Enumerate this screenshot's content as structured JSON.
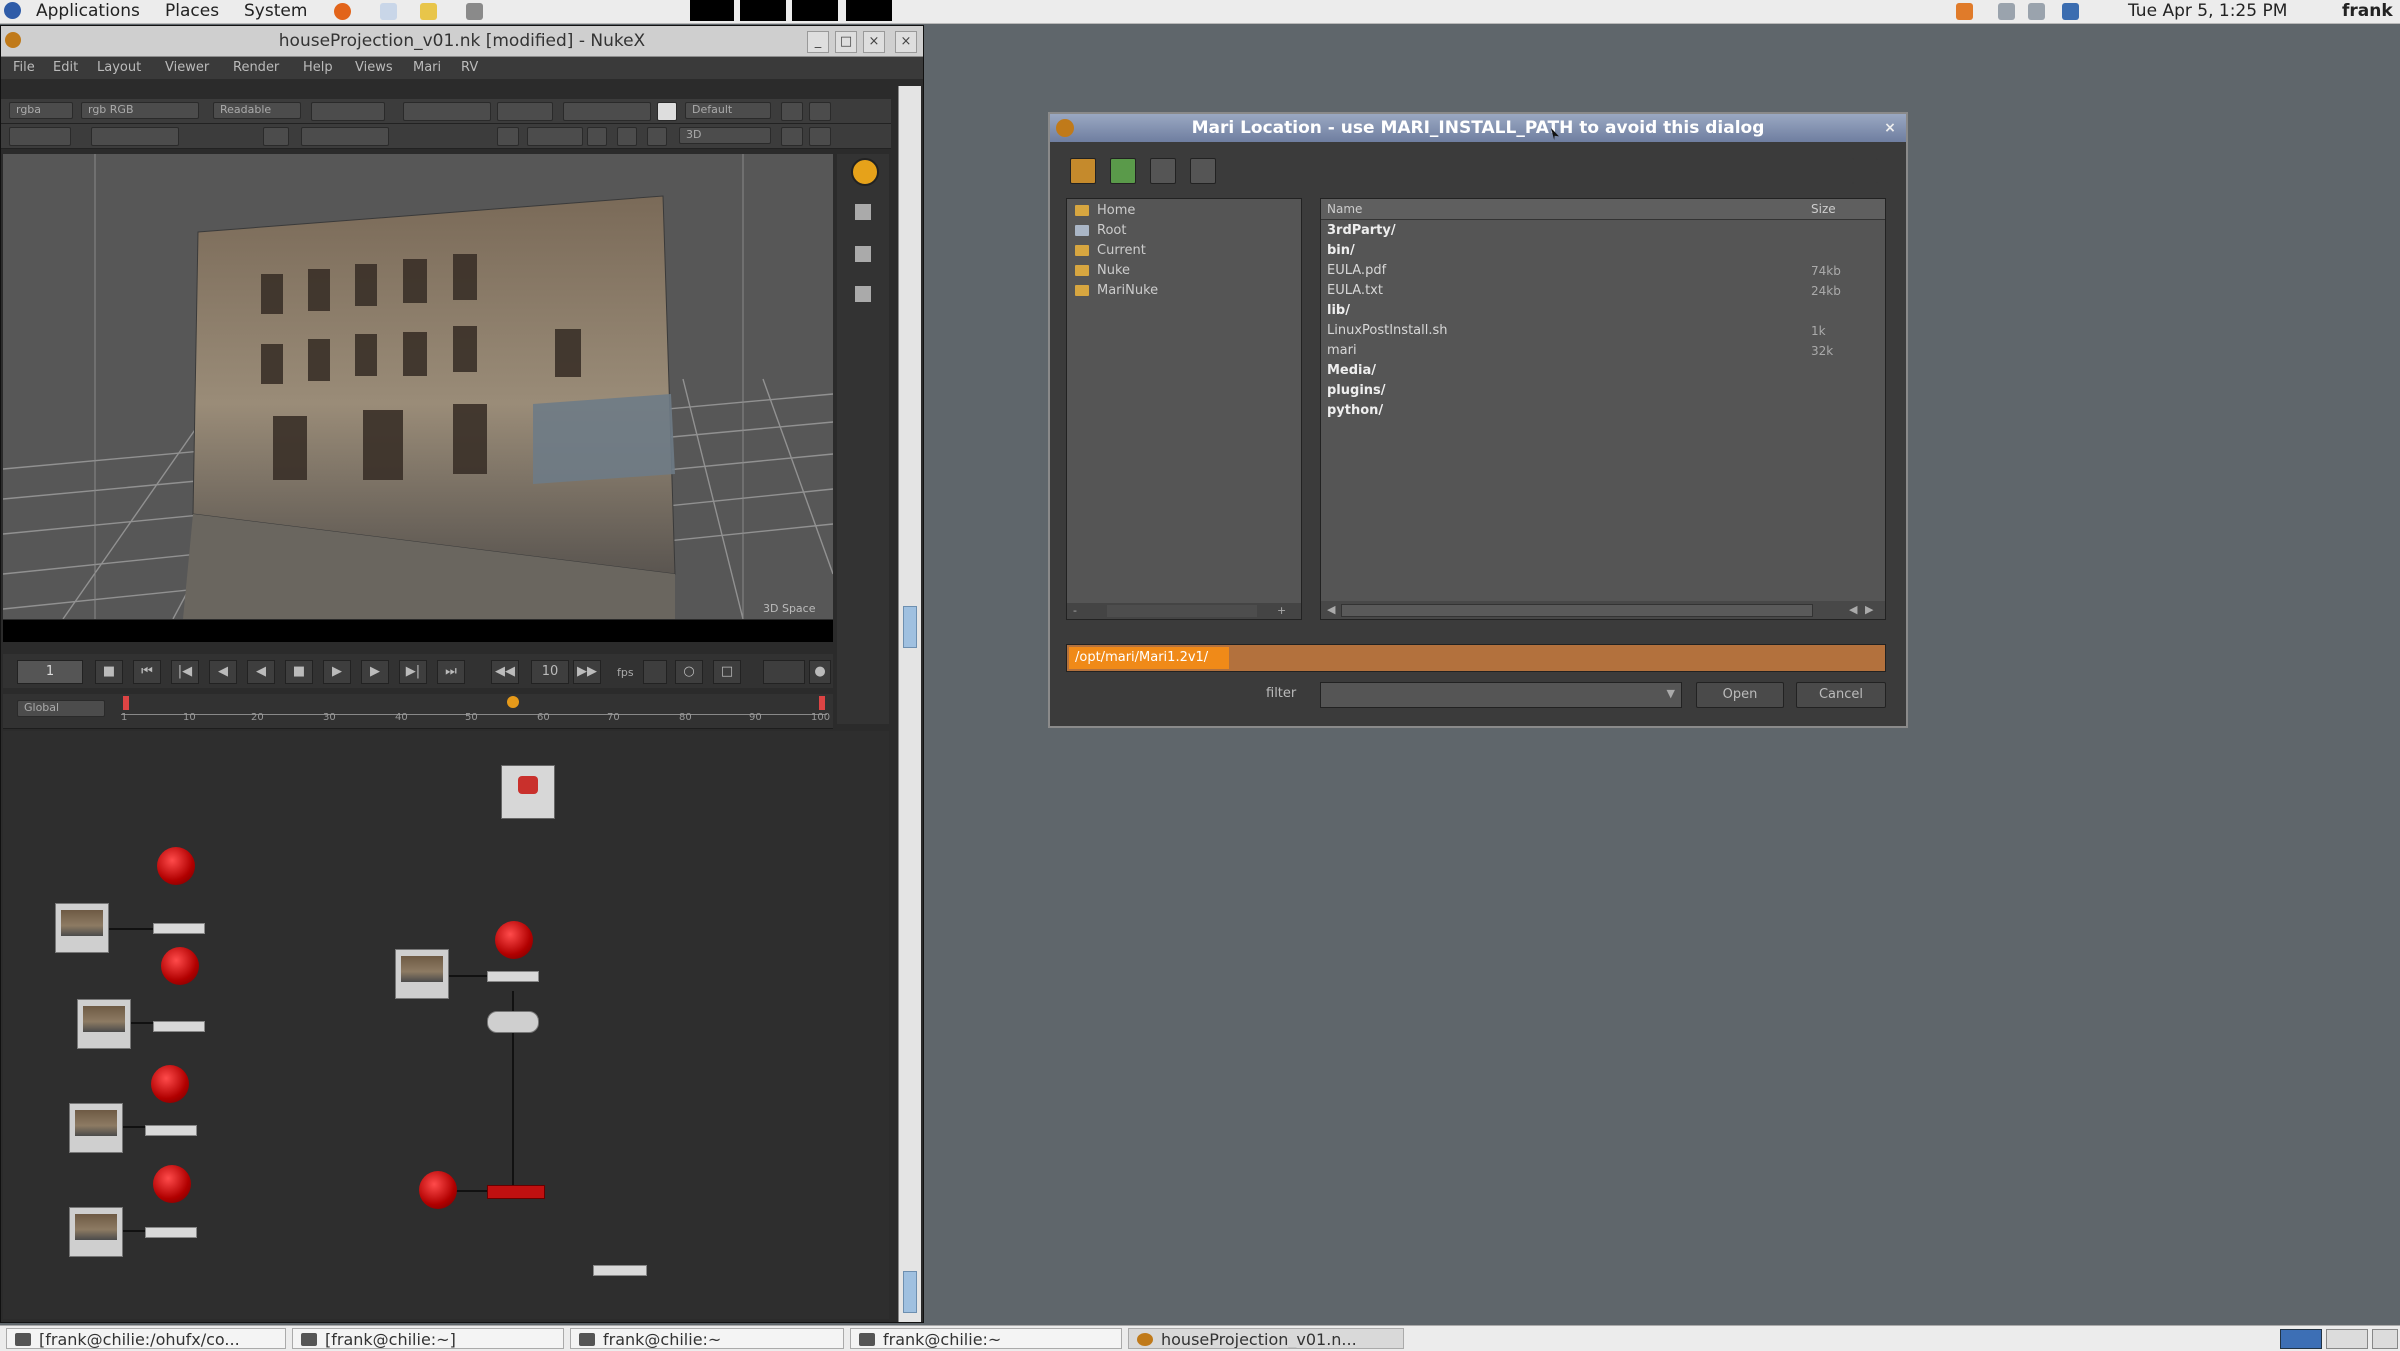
{
  "top_panel": {
    "applications": "Applications",
    "places": "Places",
    "system": "System",
    "datetime": "Tue Apr  5,  1:25 PM",
    "user": "frank"
  },
  "nuke": {
    "title": "houseProjection_v01.nk [modified] - NukeX",
    "menu": [
      "File",
      "Edit",
      "Layout",
      "Viewer",
      "Render",
      "Help",
      "Views",
      "Mari",
      "RV"
    ],
    "toolbar": {
      "channels": "rgba",
      "layer": "rgb RGB",
      "mode": "Readable",
      "zoom": "Default",
      "view_mode": "3D"
    },
    "viewer_label": "3D Space",
    "transport": {
      "frame": "1",
      "fps": "fps",
      "ruler_ticks": [
        "1",
        "10",
        "20",
        "30",
        "40",
        "50",
        "60",
        "70",
        "80",
        "90",
        "100"
      ],
      "global": "Global"
    }
  },
  "dialog": {
    "title": "Mari Location - use MARI_INSTALL_PATH to avoid this dialog",
    "places": [
      "Home",
      "Root",
      "Current",
      "Nuke",
      "MariNuke"
    ],
    "files_header": {
      "name": "Name",
      "size": "Size"
    },
    "files": [
      {
        "name": "3rdParty/",
        "size": "",
        "dir": true
      },
      {
        "name": "bin/",
        "size": "",
        "dir": true
      },
      {
        "name": "EULA.pdf",
        "size": "74kb",
        "dir": false
      },
      {
        "name": "EULA.txt",
        "size": "24kb",
        "dir": false
      },
      {
        "name": "lib/",
        "size": "",
        "dir": true
      },
      {
        "name": "LinuxPostInstall.sh",
        "size": "1k",
        "dir": false
      },
      {
        "name": "mari",
        "size": "32k",
        "dir": false
      },
      {
        "name": "Media/",
        "size": "",
        "dir": true
      },
      {
        "name": "plugins/",
        "size": "",
        "dir": true
      },
      {
        "name": "python/",
        "size": "",
        "dir": true
      }
    ],
    "path_value": "/opt/mari/Mari1.2v1/",
    "filter_label": "filter",
    "open_label": "Open",
    "cancel_label": "Cancel"
  },
  "taskbar": [
    "[frank@chilie:/ohufx/co...",
    "[frank@chilie:~]",
    "frank@chilie:~",
    "frank@chilie:~",
    "houseProjection_v01.n..."
  ],
  "colors": {
    "desktop": "#5f666b",
    "accent_orange": "#f08a18",
    "node_red": "#d10000"
  }
}
